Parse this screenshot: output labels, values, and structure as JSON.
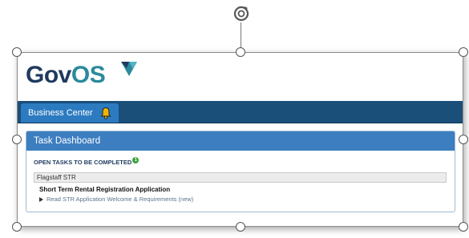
{
  "logo": {
    "text_main": "Gov",
    "text_accent": "OS"
  },
  "nav": {
    "tab_label": "Business Center",
    "bell_icon": "bell-icon"
  },
  "dashboard": {
    "title": "Task Dashboard",
    "open_tasks_label": "OPEN TASKS TO BE COMPLETED",
    "open_tasks_count": "1",
    "group_name": "Flagstaff STR",
    "application_title": "Short Term Rental Registration Application",
    "task_link": "Read STR Application Welcome & Requirements (new)"
  },
  "colors": {
    "navbar": "#1a4f7a",
    "tab": "#2c7bc0",
    "panel_header": "#3d7ec0",
    "logo_dark": "#1f3a5f",
    "logo_accent": "#2b8a9c",
    "badge": "#3aa13a"
  }
}
